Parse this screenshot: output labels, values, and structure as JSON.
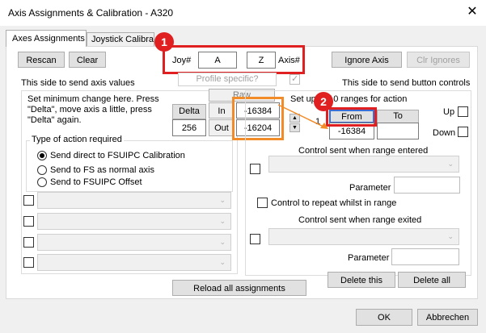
{
  "window": {
    "title": "Axis Assignments & Calibration - A320",
    "close_glyph": "✕"
  },
  "tabs": [
    {
      "label": "Axes Assignments"
    },
    {
      "label": "Joystick Calibra"
    }
  ],
  "toolbar": {
    "rescan_label": "Rescan",
    "clear_label": "Clear",
    "ignore_axis_label": "Ignore Axis",
    "clr_ignores_label": "Clr Ignores"
  },
  "joy_axis": {
    "joy_label": "Joy#",
    "joy_value": "A",
    "axis_value": "Z",
    "axis_label": "Axis#"
  },
  "profile": {
    "label": "Profile specific?",
    "checked": true
  },
  "left_side": {
    "heading": "This side to send axis values",
    "delta_text": "Set minimum change  here.  Press \"Delta\", move axis a little,  press \"Delta\" again.",
    "delta_label": "Delta",
    "delta_value": "256"
  },
  "raw": {
    "raw_label": "Raw",
    "in_label": "In",
    "in_value": "-16384",
    "out_label": "Out",
    "out_value": "-16204"
  },
  "action_type": {
    "legend": "Type of action required",
    "options": [
      {
        "label": "Send direct to FSUIPC Calibration",
        "selected": true
      },
      {
        "label": "Send to FS as normal axis",
        "selected": false
      },
      {
        "label": "Send to FSUIPC Offset",
        "selected": false
      }
    ]
  },
  "right_side": {
    "heading": "This side to send button controls",
    "ranges_text": "Set up to 10 ranges for action",
    "range_number": "1",
    "from_label": "From",
    "to_label": "To",
    "from_value": "-16384",
    "to_value": "",
    "up_label": "Up",
    "down_label": "Down",
    "entered_label": "Control sent when range entered",
    "parameter_label": "Parameter",
    "repeat_label": "Control to repeat whilst in range",
    "exited_label": "Control sent when range exited",
    "parameter2_label": "Parameter",
    "delete_this_label": "Delete this",
    "delete_all_label": "Delete all"
  },
  "reload_label": "Reload all assignments",
  "footer": {
    "ok_label": "OK",
    "cancel_label": "Abbrechen"
  },
  "annotations": {
    "badge1": "1",
    "badge2": "2",
    "red": "#e02020",
    "orange": "#f28c28"
  }
}
